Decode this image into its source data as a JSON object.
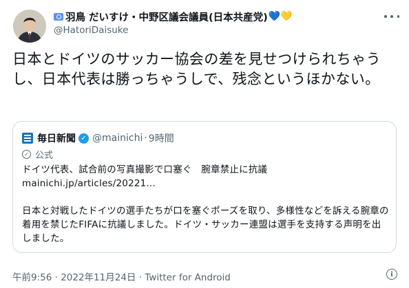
{
  "author": {
    "name": "羽鳥 だいすけ・中野区議会議員(日本共産党)",
    "hearts": "💙💛",
    "handle": "@HatoriDaisuke"
  },
  "tweet": {
    "text": "日本とドイツのサッカー協会の差を見せつけられちゃうし、日本代表は勝っちゃうしで、残念というほかない。"
  },
  "quoted": {
    "name": "毎日新聞",
    "handle": "@mainichi",
    "separator": "·",
    "time": "9時間",
    "official_label": "公式",
    "headline": "ドイツ代表、試合前の写真撮影で口塞ぐ　腕章禁止に抗議",
    "link": "mainichi.jp/articles/20221...",
    "body": "日本と対戦したドイツの選手たちが口を塞ぐポーズを取り、多様性などを訴える腕章の着用を禁じたFIFAに抗議しました。ドイツ・サッカー連盟は選手を支持する声明を出しました。"
  },
  "footer": {
    "meta": "午前9:56 · 2022年11月24日 · Twitter for Android"
  },
  "icons": {
    "more": "more-icon",
    "info": "info-icon",
    "verified": "verified-icon"
  },
  "colors": {
    "text": "#0f1419",
    "secondary": "#536471",
    "verified": "#1d9bf0",
    "border": "#cfd9de"
  }
}
